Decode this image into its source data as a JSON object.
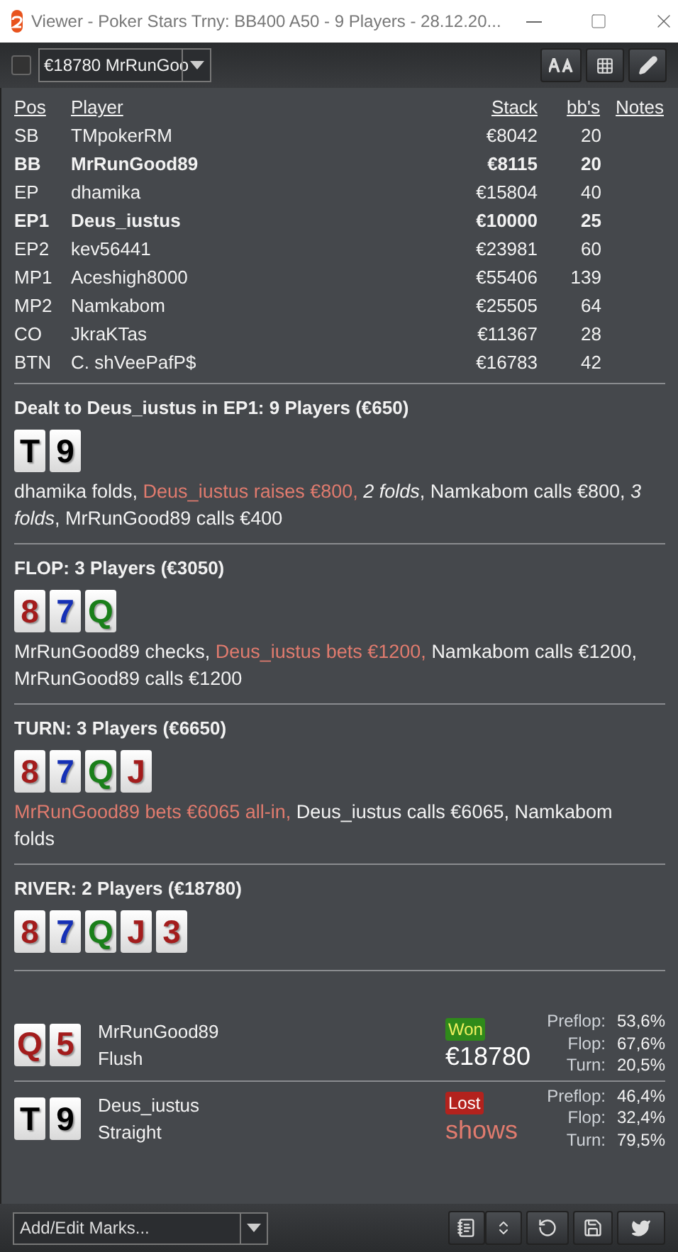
{
  "window": {
    "title": "Viewer - Poker Stars Trny: BB400 A50 - 9 Players - 28.12.20..."
  },
  "toolbar": {
    "checked": false,
    "hand_select": "€18780 MrRunGoo"
  },
  "table": {
    "columns": [
      "Pos",
      "Player",
      "Stack",
      "bb's",
      "Notes"
    ],
    "rows": [
      {
        "pos": "SB",
        "player": "TMpokerRM",
        "stack": "€8042",
        "bbs": "20",
        "highlighted": false
      },
      {
        "pos": "BB",
        "player": "MrRunGood89",
        "stack": "€8115",
        "bbs": "20",
        "highlighted": true
      },
      {
        "pos": "EP",
        "player": "dhamika",
        "stack": "€15804",
        "bbs": "40",
        "highlighted": false
      },
      {
        "pos": "EP1",
        "player": "Deus_iustus",
        "stack": "€10000",
        "bbs": "25",
        "highlighted": true
      },
      {
        "pos": "EP2",
        "player": "kev56441",
        "stack": "€23981",
        "bbs": "60",
        "highlighted": false
      },
      {
        "pos": "MP1",
        "player": "Aceshigh8000",
        "stack": "€55406",
        "bbs": "139",
        "highlighted": false
      },
      {
        "pos": "MP2",
        "player": "Namkabom",
        "stack": "€25505",
        "bbs": "64",
        "highlighted": false
      },
      {
        "pos": "CO",
        "player": "JkraKTas",
        "stack": "€11367",
        "bbs": "28",
        "highlighted": false
      },
      {
        "pos": "BTN",
        "player": "C. shVeePafP$",
        "stack": "€16783",
        "bbs": "42",
        "highlighted": false
      }
    ]
  },
  "streets": [
    {
      "title": "Dealt to Deus_iustus in EP1: 9 Players (€650)",
      "cards": [
        {
          "rank": "T",
          "color": "#000000"
        },
        {
          "rank": "9",
          "color": "#000000"
        }
      ],
      "actions": [
        {
          "kind": "normal",
          "text": "dhamika folds, "
        },
        {
          "kind": "aggressive",
          "text": "Deus_iustus raises €800, "
        },
        {
          "kind": "folds",
          "text": "2 folds"
        },
        {
          "kind": "normal",
          "text": ", Namkabom calls €800, "
        },
        {
          "kind": "folds",
          "text": "3 folds"
        },
        {
          "kind": "normal",
          "text": ", MrRunGood89 calls €400"
        }
      ]
    },
    {
      "title": "FLOP: 3 Players (€3050)",
      "cards": [
        {
          "rank": "8",
          "color": "#a31c1c"
        },
        {
          "rank": "7",
          "color": "#1530b5"
        },
        {
          "rank": "Q",
          "color": "#1a7f1a"
        }
      ],
      "actions": [
        {
          "kind": "normal",
          "text": "MrRunGood89 checks, "
        },
        {
          "kind": "aggressive",
          "text": "Deus_iustus bets €1200, "
        },
        {
          "kind": "normal",
          "text": "Namkabom calls €1200, MrRunGood89 calls €1200"
        }
      ]
    },
    {
      "title": "TURN: 3 Players (€6650)",
      "cards": [
        {
          "rank": "8",
          "color": "#a31c1c"
        },
        {
          "rank": "7",
          "color": "#1530b5"
        },
        {
          "rank": "Q",
          "color": "#1a7f1a"
        },
        {
          "rank": "J",
          "color": "#a31c1c"
        }
      ],
      "actions": [
        {
          "kind": "aggressive",
          "text": "MrRunGood89 bets €6065 all-in, "
        },
        {
          "kind": "normal",
          "text": "Deus_iustus calls €6065, Namkabom folds"
        }
      ]
    },
    {
      "title": "RIVER: 2 Players (€18780)",
      "cards": [
        {
          "rank": "8",
          "color": "#a31c1c"
        },
        {
          "rank": "7",
          "color": "#1530b5"
        },
        {
          "rank": "Q",
          "color": "#1a7f1a"
        },
        {
          "rank": "J",
          "color": "#a31c1c"
        },
        {
          "rank": "3",
          "color": "#a31c1c"
        }
      ]
    }
  ],
  "showdown": [
    {
      "cards": [
        {
          "rank": "Q",
          "color": "#a31c1c"
        },
        {
          "rank": "5",
          "color": "#a31c1c"
        }
      ],
      "player": "MrRunGood89",
      "hand": "Flush",
      "kind": "won",
      "badge": "Won",
      "amount": "€18780",
      "equity": [
        {
          "label": "Preflop:",
          "value": "53,6%"
        },
        {
          "label": "Flop:",
          "value": "67,6%"
        },
        {
          "label": "Turn:",
          "value": "20,5%"
        }
      ]
    },
    {
      "cards": [
        {
          "rank": "T",
          "color": "#000000"
        },
        {
          "rank": "9",
          "color": "#000000"
        }
      ],
      "player": "Deus_iustus",
      "hand": "Straight",
      "kind": "lost",
      "badge": "Lost",
      "amount": "shows",
      "equity": [
        {
          "label": "Preflop:",
          "value": "46,4%"
        },
        {
          "label": "Flop:",
          "value": "32,4%"
        },
        {
          "label": "Turn:",
          "value": "79,5%"
        }
      ]
    }
  ],
  "footer": {
    "marks_placeholder": "Add/Edit Marks..."
  }
}
